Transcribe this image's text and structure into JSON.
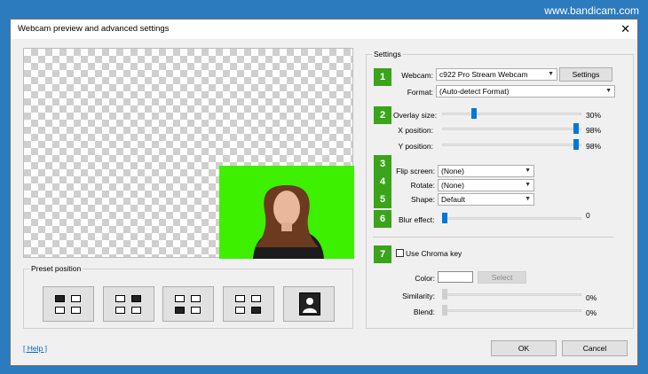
{
  "watermark": "www.bandicam.com",
  "window": {
    "title": "Webcam preview and advanced settings"
  },
  "preset": {
    "title": "Preset position",
    "buttons": [
      "top-left",
      "top-right",
      "bottom-left",
      "bottom-right",
      "full"
    ]
  },
  "settings": {
    "title": "Settings",
    "webcam": {
      "label": "Webcam:",
      "value": "c922 Pro Stream Webcam",
      "settings_label": "Settings"
    },
    "format": {
      "label": "Format:",
      "value": "(Auto-detect Format)"
    },
    "overlay": {
      "label": "Overlay size:",
      "value": "30%"
    },
    "xpos": {
      "label": "X position:",
      "value": "98%"
    },
    "ypos": {
      "label": "Y position:",
      "value": "98%"
    },
    "flip": {
      "label": "Flip screen:",
      "value": "(None)"
    },
    "rotate": {
      "label": "Rotate:",
      "value": "(None)"
    },
    "shape": {
      "label": "Shape:",
      "value": "Default"
    },
    "blur": {
      "label": "Blur effect:",
      "value": "0"
    },
    "chroma": {
      "label": "Use Chroma key"
    },
    "color": {
      "label": "Color:",
      "select_label": "Select"
    },
    "similarity": {
      "label": "Similarity:",
      "value": "0%"
    },
    "blend": {
      "label": "Blend:",
      "value": "0%"
    }
  },
  "badges": [
    "1",
    "2",
    "3",
    "4",
    "5",
    "6",
    "7"
  ],
  "footer": {
    "help": "[ Help ]",
    "ok": "OK",
    "cancel": "Cancel"
  }
}
